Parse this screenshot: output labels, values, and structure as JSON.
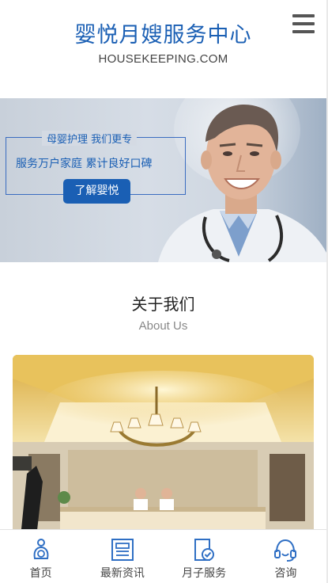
{
  "header": {
    "title": "婴悦月嫂服务中心",
    "subtitle": "HOUSEKEEPING.COM",
    "menu_icon": "hamburger-menu-icon"
  },
  "banner": {
    "line1": "母婴护理 我们更专",
    "line2": "服务万户家庭 累计良好口碑",
    "button_label": "了解婴悦"
  },
  "about": {
    "title": "关于我们",
    "subtitle": "About Us"
  },
  "bottom_nav": [
    {
      "label": "首页",
      "icon": "home-baby-icon"
    },
    {
      "label": "最新资讯",
      "icon": "news-icon"
    },
    {
      "label": "月子服务",
      "icon": "service-check-icon"
    },
    {
      "label": "咨询",
      "icon": "headset-icon"
    }
  ],
  "colors": {
    "brand_blue": "#1a5fb4",
    "icon_blue": "#2f6fc4"
  }
}
